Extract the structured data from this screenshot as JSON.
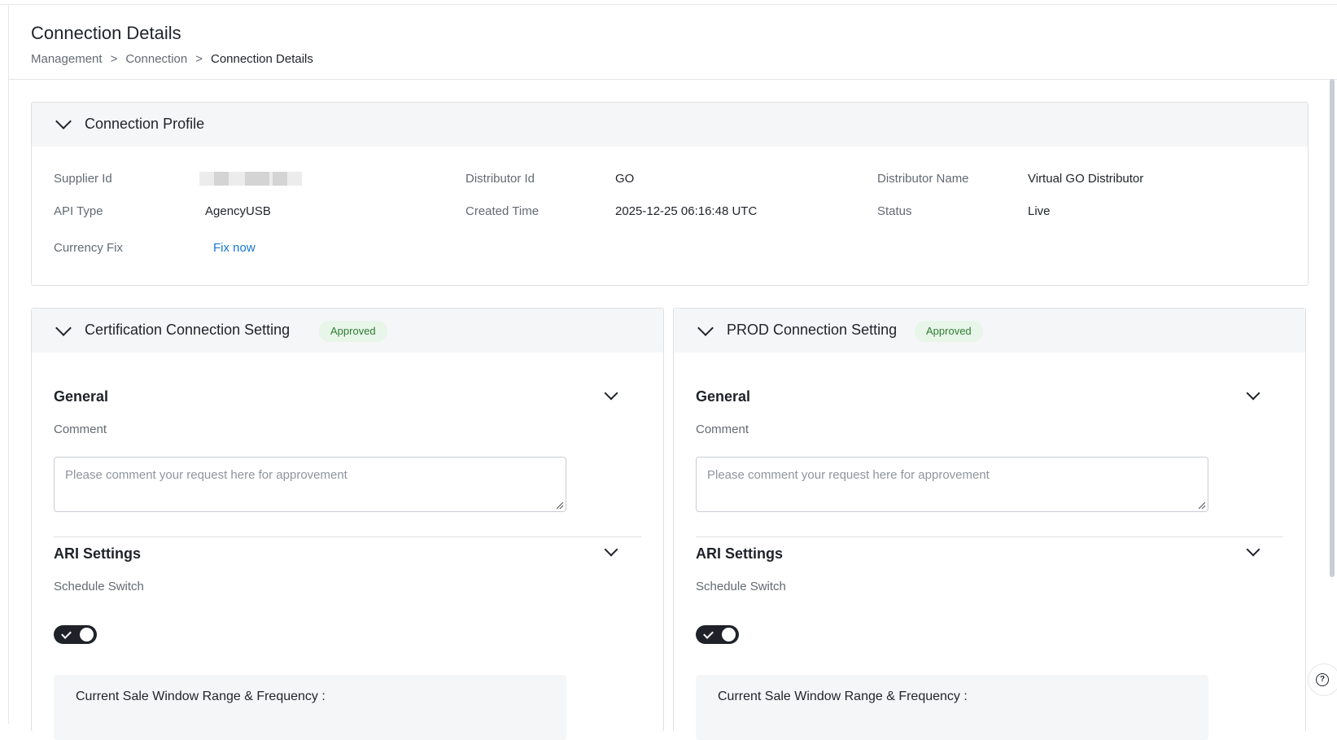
{
  "page": {
    "title": "Connection Details",
    "breadcrumb": [
      "Management",
      "Connection",
      "Connection Details"
    ],
    "breadcrumb_separator": ">"
  },
  "profile": {
    "title": "Connection Profile",
    "fields": [
      {
        "label": "Supplier Id",
        "value": ""
      },
      {
        "label": "Distributor Id",
        "value": "GO"
      },
      {
        "label": "Distributor Name",
        "value": "Virtual GO Distributor"
      },
      {
        "label": "API Type",
        "value": "AgencyUSB"
      },
      {
        "label": "Created Time",
        "value": "2025-12-25 06:16:48 UTC"
      },
      {
        "label": "Status",
        "value": "Live"
      },
      {
        "label": "Currency Fix",
        "value": "Fix now"
      }
    ]
  },
  "cert": {
    "title": "Certification Connection Setting",
    "badge": "Approved",
    "general_title": "General",
    "comment_label": "Comment",
    "comment_placeholder": "Please comment your request here for approvement",
    "ari_title": "ARI Settings",
    "schedule_label": "Schedule Switch",
    "schedule_on": true,
    "sale_window_title": "Current Sale Window Range & Frequency :"
  },
  "prod": {
    "title": "PROD Connection Setting",
    "badge": "Approved",
    "general_title": "General",
    "comment_label": "Comment",
    "comment_placeholder": "Please comment your request here for approvement",
    "ari_title": "ARI Settings",
    "schedule_label": "Schedule Switch",
    "schedule_on": true,
    "sale_window_title": "Current Sale Window Range & Frequency :"
  },
  "colors": {
    "link": "#1677d2",
    "badge_bg": "#e8f5e9",
    "badge_text": "#2e7d32",
    "toggle_on": "#1f2329"
  },
  "icons": [
    "chevron-down-icon",
    "check-icon",
    "help-icon"
  ]
}
